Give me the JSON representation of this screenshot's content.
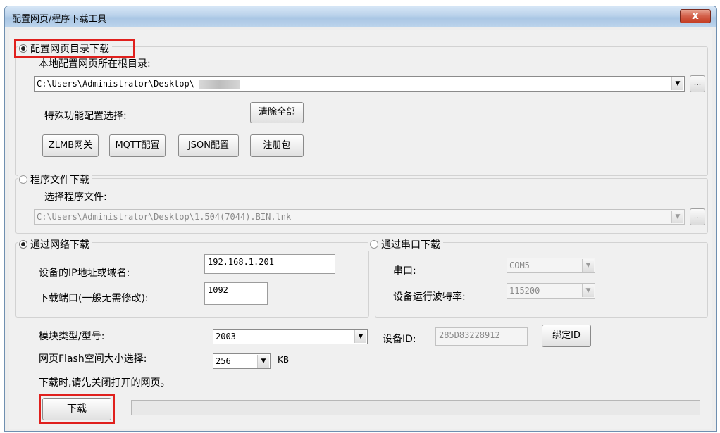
{
  "window": {
    "title": "配置网页/程序下载工具",
    "close_label": "x"
  },
  "web_config": {
    "option_label": "配置网页目录下载",
    "root_dir_label": "本地配置网页所在根目录:",
    "root_dir_value": "C:\\Users\\Administrator\\Desktop\\",
    "browse_label": "...",
    "special_config_label": "特殊功能配置选择:",
    "clear_all_label": "清除全部",
    "buttons": [
      "ZLMB网关",
      "MQTT配置",
      "JSON配置",
      "注册包"
    ]
  },
  "program_file": {
    "option_label": "程序文件下载",
    "select_label": "选择程序文件:",
    "file_value": "C:\\Users\\Administrator\\Desktop\\1.504(7044).BIN.lnk",
    "browse_label": "..."
  },
  "network": {
    "option_label": "通过网络下载",
    "ip_label": "设备的IP地址或域名:",
    "ip_value": "192.168.1.201",
    "port_label": "下载端口(一般无需修改):",
    "port_value": "1092"
  },
  "serial": {
    "option_label": "通过串口下载",
    "port_label": "串口:",
    "port_value": "COM5",
    "baud_label": "设备运行波特率:",
    "baud_value": "115200"
  },
  "module": {
    "type_label": "模块类型/型号:",
    "type_value": "2003",
    "device_id_label": "设备ID:",
    "device_id_value": "285D83228912",
    "bind_id_label": "绑定ID",
    "flash_label": "网页Flash空间大小选择:",
    "flash_value": "256",
    "flash_unit": "KB",
    "note": "下载时,请先关闭打开的网页。"
  },
  "download_label": "下载",
  "progress": 0
}
